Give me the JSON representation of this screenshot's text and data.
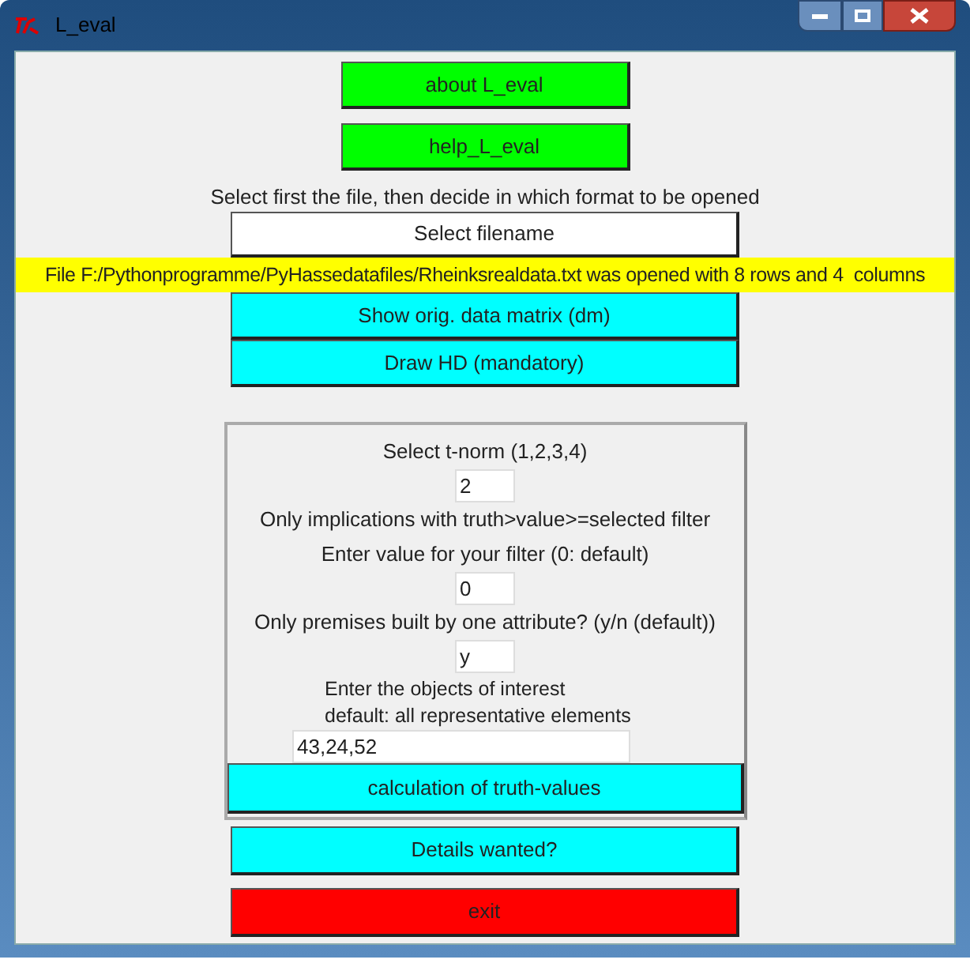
{
  "window": {
    "title": "L_eval"
  },
  "top_buttons": [
    {
      "label": "about L_eval",
      "color": "#00ff00"
    },
    {
      "label": "help_L_eval",
      "color": "#00ff00"
    }
  ],
  "instruction": "Select first the file, then decide in which format to be opened",
  "file_button": {
    "label": "Select filename",
    "color": "#ffffff"
  },
  "status": "File F:/Pythonprogramme/PyHassedatafiles/Rheinksrealdata.txt was opened with 8 rows and 4  columns",
  "data_buttons": [
    {
      "label": "Show orig. data matrix (dm)",
      "color": "#00ffff"
    },
    {
      "label": "Draw HD (mandatory)",
      "color": "#00ffff"
    }
  ],
  "panel": {
    "items": [
      {
        "kind": "label",
        "text": "Select t-norm (1,2,3,4)"
      },
      {
        "kind": "short_entry",
        "value": "2"
      },
      {
        "kind": "label",
        "text": "Only implications with truth>value>=selected filter"
      },
      {
        "kind": "label",
        "text": "Enter value for your filter (0: default)"
      },
      {
        "kind": "short_entry",
        "value": "0"
      },
      {
        "kind": "label",
        "text": "Only premises built by one attribute? (y/n (default))"
      },
      {
        "kind": "short_entry",
        "value": "y"
      },
      {
        "kind": "note",
        "lines": [
          "Enter the objects of interest",
          "default: all representative elements"
        ]
      },
      {
        "kind": "long_entry",
        "value": "43,24,52"
      }
    ],
    "button": {
      "label": "calculation of truth-values",
      "color": "#00ffff"
    }
  },
  "bottom_buttons": [
    {
      "label": "Details wanted?",
      "color": "#00ffff"
    },
    {
      "label": "exit",
      "color": "#ff0000"
    }
  ]
}
